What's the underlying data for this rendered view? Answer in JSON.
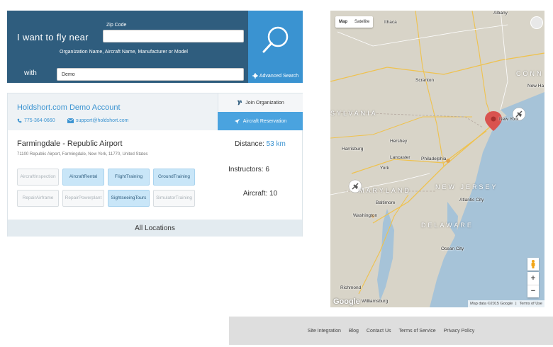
{
  "search": {
    "fly_label": "I want to fly near",
    "zip_caption": "Zip Code",
    "zip_value": "",
    "with_label": "with",
    "org_caption": "Organization Name, Aircraft Name, Manufacturer or Model",
    "org_value": "Demo",
    "advanced_label": "Advanced Search",
    "colors": {
      "panel": "#2f5d7e",
      "button": "#3a93d1"
    }
  },
  "result": {
    "account_name": "Holdshort.com Demo Account",
    "phone": "775-364-0660",
    "email": "support@holdshort.com",
    "join_label": "Join Organization",
    "reserve_label": "Aircraft Reservation",
    "airport_name": "Farmingdale - Republic Airport",
    "airport_address": "71100 Republic Airport, Farmingdale, New York, 11770, United States",
    "distance_label": "Distance:",
    "distance_value": "53 km",
    "instructors": "Instructors: 6",
    "aircraft": "Aircraft: 10",
    "services": [
      {
        "line1": "Aircraft",
        "line2": "Inspection",
        "active": false
      },
      {
        "line1": "Aircraft",
        "line2": "Rental",
        "active": true
      },
      {
        "line1": "Flight",
        "line2": "Training",
        "active": true
      },
      {
        "line1": "Ground",
        "line2": "Training",
        "active": true
      },
      {
        "line1": "Repair",
        "line2": "Airframe",
        "active": false
      },
      {
        "line1": "Repair",
        "line2": "Powerplant",
        "active": false
      },
      {
        "line1": "Sightseeing",
        "line2": "Tours",
        "active": true
      },
      {
        "line1": "Simulator",
        "line2": "Training",
        "active": false
      }
    ],
    "all_locations": "All Locations"
  },
  "map": {
    "type_map": "Map",
    "type_satellite": "Satellite",
    "labels": {
      "albany": "Albany",
      "ithaca": "Ithaca",
      "scranton": "Scranton",
      "new_haven": "New Ha",
      "new_york": "New York",
      "harrisburg": "Harrisburg",
      "hershey": "Hershey",
      "lancaster": "Lancaster",
      "york": "York",
      "philadelphia": "Philadelphia",
      "baltimore": "Baltimore",
      "washington": "Washington",
      "atlantic_city": "Atlantic City",
      "ocean_city": "Ocean City",
      "richmond": "Richmond",
      "williamsburg": "Williamsburg"
    },
    "states": {
      "pennsylvania": "SYLVANIA",
      "maryland": "MARYLAND",
      "new_jersey": "NEW JERSEY",
      "delaware": "DELAWARE",
      "connecticut": "CONN"
    },
    "google": "Google",
    "map_data": "Map data ©2015 Google",
    "terms": "Terms of Use",
    "water_color": "#a6c3d8",
    "land_color": "#d8d4c8",
    "pin_color": "#d9534f"
  },
  "footer": {
    "links": [
      "Site Integration",
      "Blog",
      "Contact Us",
      "Terms of Service",
      "Privacy Policy"
    ]
  }
}
